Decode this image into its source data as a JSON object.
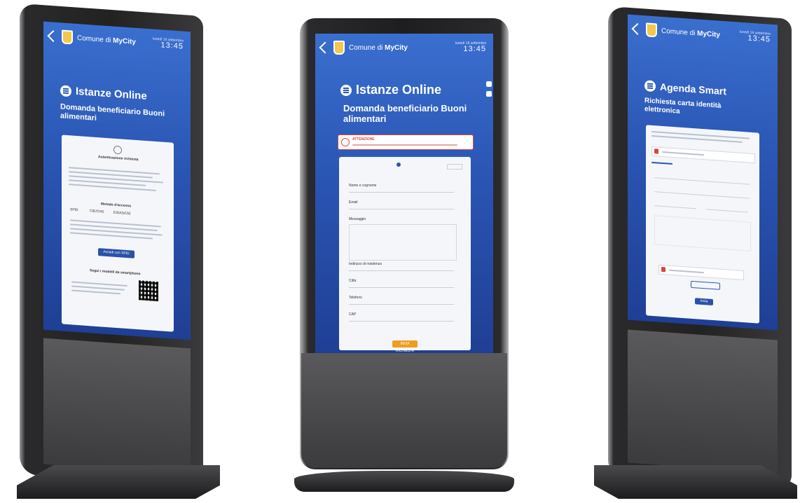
{
  "kiosks": [
    {
      "header": {
        "municipality_prefix": "Comune di",
        "municipality_name": "MyCity",
        "date": "lunedì 16 settembre",
        "time": "13:45"
      },
      "service_title": "Istanze Online",
      "page_subtitle": "Domanda beneficiario Buoni alimentari",
      "card": {
        "heading": "Autenticazione richiesta",
        "methods_title": "Metodo d'accesso",
        "tabs": [
          "SPID",
          "CIE/CNS",
          "EIDAS/CIE"
        ],
        "login_button": "Accedi con SPID",
        "smartphone_title": "Segui i modelli da smartphone"
      }
    },
    {
      "header": {
        "municipality_prefix": "Comune di",
        "municipality_name": "MyCity",
        "date": "lunedì 16 settembre",
        "time": "13:45"
      },
      "service_title": "Istanze Online",
      "page_subtitle": "Domanda beneficiario Buoni alimentari",
      "alert": {
        "title": "ATTENZIONE"
      },
      "form": {
        "fields": [
          "Nome e cognome",
          "Email",
          "Messaggio",
          "Indirizzo di residenza",
          "Città",
          "Telefono",
          "CAP"
        ],
        "submit_label": "INVIA RICHIESTA"
      }
    },
    {
      "header": {
        "municipality_prefix": "Comune di",
        "municipality_name": "MyCity",
        "date": "lunedì 16 settembre",
        "time": "13:45"
      },
      "service_title": "Agenda Smart",
      "page_subtitle": "Richiesta carta identità elettronica",
      "form": {
        "submit_label": "Invia"
      }
    }
  ]
}
